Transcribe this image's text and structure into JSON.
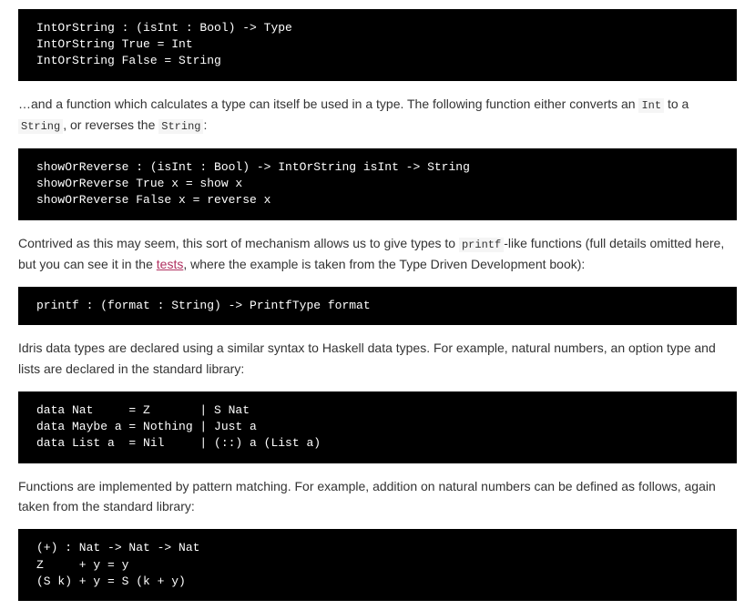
{
  "code_blocks": {
    "block1": "IntOrString : (isInt : Bool) -> Type\nIntOrString True = Int\nIntOrString False = String",
    "block2": "showOrReverse : (isInt : Bool) -> IntOrString isInt -> String\nshowOrReverse True x = show x\nshowOrReverse False x = reverse x",
    "block3": "printf : (format : String) -> PrintfType format",
    "block4": "data Nat     = Z       | S Nat\ndata Maybe a = Nothing | Just a\ndata List a  = Nil     | (::) a (List a)",
    "block5": "(+) : Nat -> Nat -> Nat\nZ     + y = y\n(S k) + y = S (k + y)"
  },
  "paragraphs": {
    "p1_part1": "…and a function which calculates a type can itself be used in a type. The following function either converts an ",
    "p1_code1": "Int",
    "p1_part2": " to a ",
    "p1_code2": "String",
    "p1_part3": ", or reverses the ",
    "p1_code3": "String",
    "p1_part4": ":",
    "p2_part1": "Contrived as this may seem, this sort of mechanism allows us to give types to ",
    "p2_code1": "printf",
    "p2_part2": "-like functions (full details omitted here, but you can see it in the ",
    "p2_link": "tests",
    "p2_part3": ", where the example is taken from the Type Driven Development book):",
    "p3": "Idris data types are declared using a similar syntax to Haskell data types. For example, natural numbers, an option type and lists are declared in the standard library:",
    "p4": "Functions are implemented by pattern matching. For example, addition on natural numbers can be defined as follows, again taken from the standard library:"
  }
}
